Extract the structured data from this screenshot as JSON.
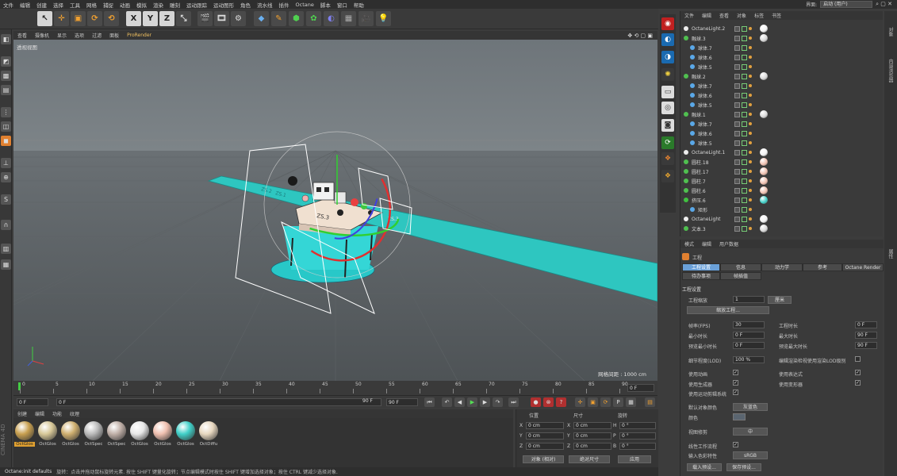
{
  "menubar": {
    "items": [
      "文件",
      "编辑",
      "创建",
      "选择",
      "工具",
      "网格",
      "捕捉",
      "动画",
      "模拟",
      "渲染",
      "雕刻",
      "运动跟踪",
      "运动图形",
      "角色",
      "流水线",
      "插件",
      "Octane",
      "脚本",
      "窗口",
      "帮助"
    ],
    "interface_label": "界面:",
    "interface_value": "启动 (用户)"
  },
  "toolbar": {
    "x": "X",
    "y": "Y",
    "z": "Z"
  },
  "viewport": {
    "menu": [
      "查看",
      "摄像机",
      "显示",
      "选项",
      "过滤",
      "面板",
      "ProRender"
    ],
    "view_name": "透视视图",
    "grid_info": "网格间距 : 1000 cm",
    "sign_a": "ZS.2",
    "sign_b": "ZS.1",
    "sign_c": "ZS.3",
    "sign_d": "ZS.3"
  },
  "timeline": {
    "ticks": [
      "0",
      "5",
      "10",
      "15",
      "20",
      "25",
      "30",
      "35",
      "40",
      "45",
      "50",
      "55",
      "60",
      "65",
      "70",
      "75",
      "80",
      "85",
      "90"
    ],
    "end_field": "0 F"
  },
  "transport": {
    "start": "0 F",
    "cur": "0 F",
    "max1": "90 F",
    "max2": "90 F"
  },
  "materials": {
    "menu": [
      "创建",
      "编辑",
      "功能",
      "纹理"
    ],
    "items": [
      "OctGlos",
      "OctGlos",
      "OctGlos",
      "OctSpec",
      "OctSpec",
      "OctGlos",
      "OctGlos",
      "OctGlos",
      "OctDiffu"
    ],
    "colors": [
      "#c8a050",
      "#d8c898",
      "#d0b070",
      "#bbbbbb",
      "#c0b0a8",
      "#e8e8e8",
      "#f0c0b0",
      "#40d0c8",
      "#e8d8c0"
    ]
  },
  "coords": {
    "h_pos": "位置",
    "h_size": "尺寸",
    "h_rot": "旋转",
    "rows": [
      {
        "a": "X",
        "v1": "0 cm",
        "b": "X",
        "v2": "0 cm",
        "c": "H",
        "v3": "0 °"
      },
      {
        "a": "Y",
        "v1": "0 cm",
        "b": "Y",
        "v2": "0 cm",
        "c": "P",
        "v3": "0 °"
      },
      {
        "a": "Z",
        "v1": "0 cm",
        "b": "Z",
        "v2": "0 cm",
        "c": "B",
        "v3": "0 °"
      }
    ],
    "mode1": "对象 (相对)",
    "mode2": "绝对尺寸",
    "apply": "应用"
  },
  "status": {
    "left": "Octane:init defaults",
    "msg": "旋转：点击并拖动鼠标旋转元素. 按住 SHIFT 键量化旋转；节点编辑模式时按住 SHIFT 键增加选择对象；按住 CTRL 键减少选择对象."
  },
  "objects": {
    "menu": [
      "文件",
      "编辑",
      "查看",
      "对象",
      "标签",
      "书签"
    ],
    "rows": [
      {
        "name": "OctaneLight.2",
        "indent": 0,
        "tag": "light"
      },
      {
        "name": "融球.3",
        "indent": 0,
        "tag": "ball"
      },
      {
        "name": "球体.7",
        "indent": 1,
        "tag": ""
      },
      {
        "name": "球体.6",
        "indent": 1,
        "tag": ""
      },
      {
        "name": "球体.5",
        "indent": 1,
        "tag": ""
      },
      {
        "name": "融球.2",
        "indent": 0,
        "tag": "ball"
      },
      {
        "name": "球体.7",
        "indent": 1,
        "tag": ""
      },
      {
        "name": "球体.6",
        "indent": 1,
        "tag": ""
      },
      {
        "name": "球体.5",
        "indent": 1,
        "tag": ""
      },
      {
        "name": "融球.1",
        "indent": 0,
        "tag": "ball"
      },
      {
        "name": "球体.7",
        "indent": 1,
        "tag": ""
      },
      {
        "name": "球体.6",
        "indent": 1,
        "tag": ""
      },
      {
        "name": "球体.5",
        "indent": 1,
        "tag": ""
      },
      {
        "name": "OctaneLight.1",
        "indent": 0,
        "tag": "light"
      },
      {
        "name": "圆柱.18",
        "indent": 0,
        "tag": "pink"
      },
      {
        "name": "圆柱.17",
        "indent": 0,
        "tag": "pink"
      },
      {
        "name": "圆柱.7",
        "indent": 0,
        "tag": "pink"
      },
      {
        "name": "圆柱.6",
        "indent": 0,
        "tag": "pink"
      },
      {
        "name": "挤压.6",
        "indent": 0,
        "tag": "cyan"
      },
      {
        "name": "矩形",
        "indent": 1,
        "tag": ""
      },
      {
        "name": "OctaneLight",
        "indent": 0,
        "tag": "light"
      },
      {
        "name": "文本.3",
        "indent": 0,
        "tag": "ball"
      }
    ]
  },
  "attributes": {
    "menu": [
      "模式",
      "编辑",
      "用户数据"
    ],
    "title": "工程",
    "tabs": [
      "工程设置",
      "信息",
      "动力学",
      "参考",
      "Octane Render"
    ],
    "tabs2": [
      "待办事项",
      "帧插值"
    ],
    "section": "工程设置",
    "scale_label": "工程缩放",
    "scale_value": "1",
    "scale_unit": "厘米",
    "scale_btn": "缩放工程...",
    "fps_label": "帧率(FPS)",
    "fps": "30",
    "length_label": "工程时长",
    "length": "0 F",
    "min_label": "最小时长",
    "min": "0 F",
    "max_label": "最大时长",
    "max": "90 F",
    "pmin_label": "预览最小时长",
    "pmin": "0 F",
    "pmax_label": "预览最大时长",
    "pmax": "90 F",
    "lod_label": "细节程度(LOD)",
    "lod": "100 %",
    "lod_cb": "编辑渲染检视使用渲染LOD级别",
    "anim_label": "使用动画",
    "expr_label": "使用表达式",
    "gen_label": "使用生成器",
    "def_label": "使用变形器",
    "motion_label": "使用运动剪辑系统",
    "defcolor_label": "默认对象颜色",
    "defcolor": "灰蓝色",
    "color_label": "颜色",
    "view_label": "视图修剪",
    "view": "中",
    "linear_label": "线性工作流程",
    "input_label": "输入色彩特性",
    "input": "sRGB",
    "btn_load": "载入预设...",
    "btn_save": "保存预设..."
  }
}
